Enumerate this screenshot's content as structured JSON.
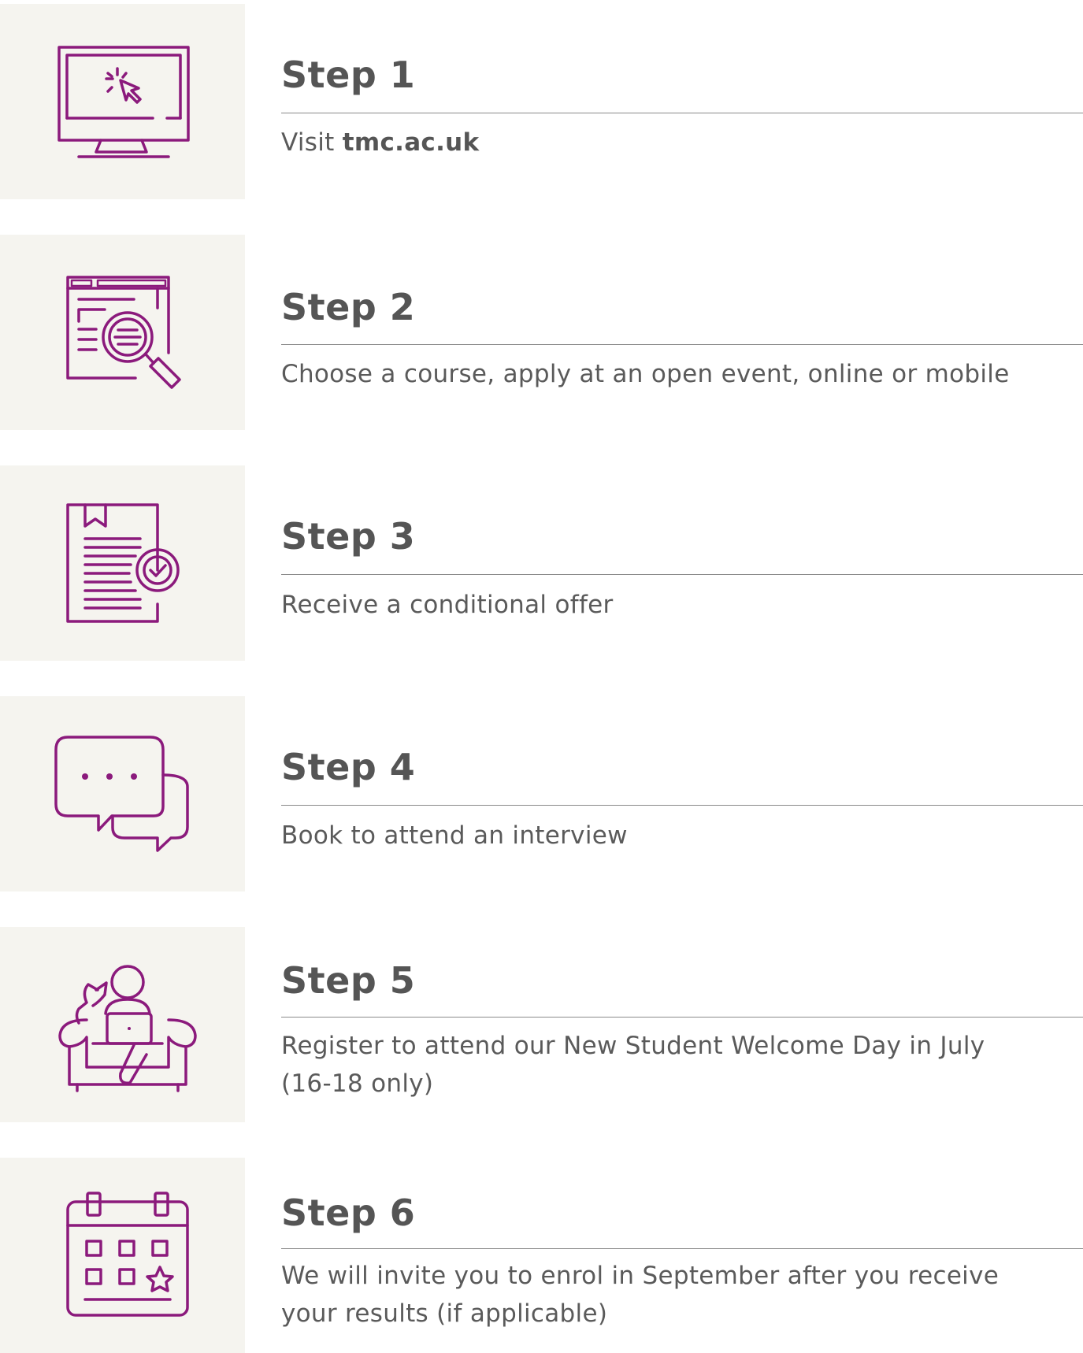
{
  "accent_color": "#8b1a7c",
  "panel_color": "#f5f4ef",
  "steps": [
    {
      "title": "Step 1",
      "text_prefix": "Visit ",
      "text_bold": "tmc.ac.uk",
      "icon": "computer-click-icon"
    },
    {
      "title": "Step 2",
      "text": "Choose a course, apply at an open event, online or mobile",
      "icon": "web-search-icon"
    },
    {
      "title": "Step 3",
      "text": "Receive a conditional offer",
      "icon": "approved-document-icon"
    },
    {
      "title": "Step 4",
      "text": "Book to attend an interview",
      "icon": "chat-bubbles-icon"
    },
    {
      "title": "Step 5",
      "text_line1": "Register to attend our New Student Welcome Day in July",
      "text_line2": "(16-18 only)",
      "icon": "person-laptop-armchair-icon"
    },
    {
      "title": "Step 6",
      "text_line1": "We will invite you to enrol in September after you receive",
      "text_line2": "your results (if applicable)",
      "icon": "calendar-star-icon"
    }
  ]
}
